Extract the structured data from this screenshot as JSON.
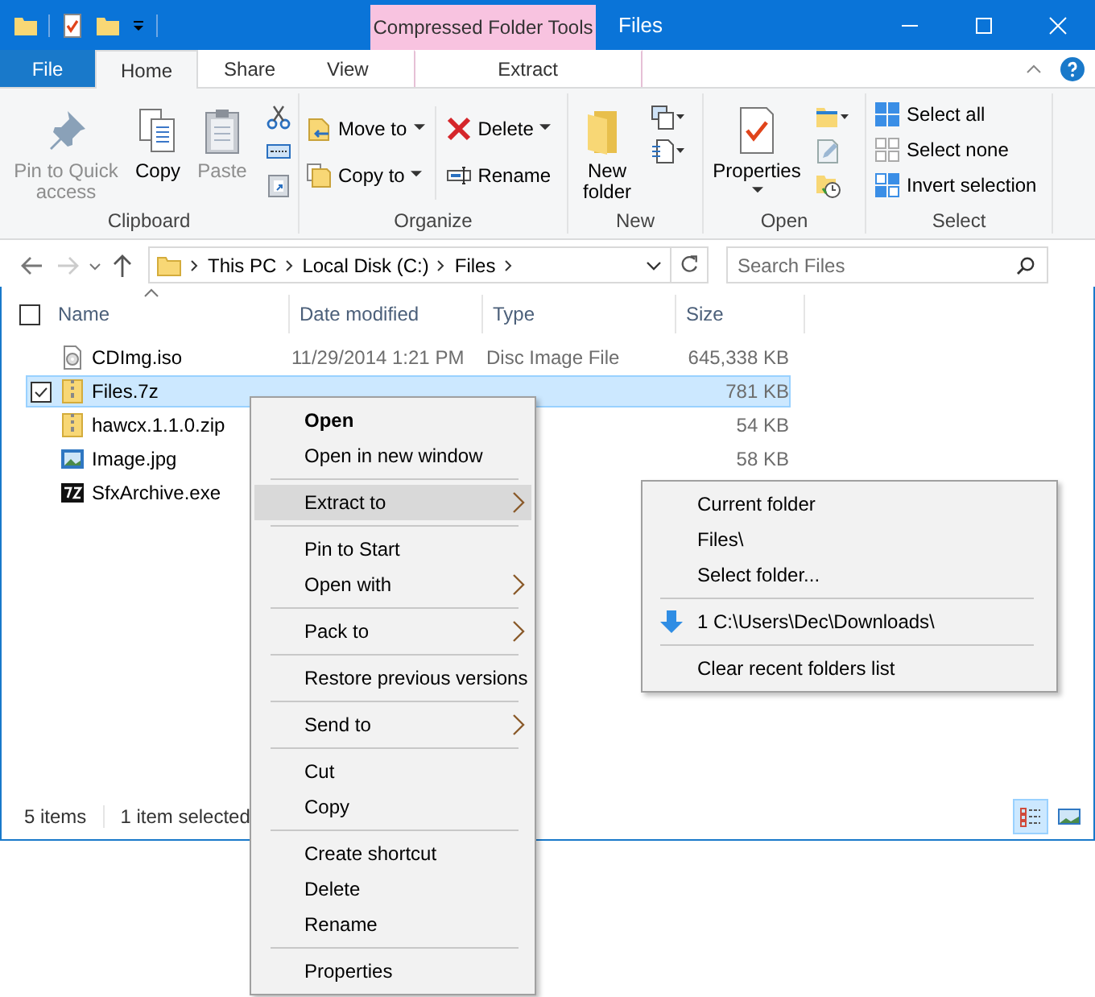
{
  "title_bar": {
    "title": "Files",
    "contextual_group": "Compressed Folder Tools"
  },
  "ribbon_tabs": [
    {
      "label": "File",
      "kind": "file",
      "selected": false
    },
    {
      "label": "Home",
      "kind": "normal",
      "selected": true
    },
    {
      "label": "Share",
      "kind": "normal",
      "selected": false
    },
    {
      "label": "View",
      "kind": "normal",
      "selected": false
    },
    {
      "label": "Extract",
      "kind": "contextual",
      "selected": false
    }
  ],
  "ribbon": {
    "clipboard": {
      "label": "Clipboard",
      "pin": {
        "label": "Pin to Quick access",
        "disabled": true
      },
      "copy": {
        "label": "Copy",
        "disabled": false
      },
      "paste": {
        "label": "Paste",
        "disabled": true
      }
    },
    "organize": {
      "label": "Organize",
      "move_to": {
        "label": "Move to"
      },
      "copy_to": {
        "label": "Copy to"
      },
      "delete": {
        "label": "Delete"
      },
      "rename": {
        "label": "Rename"
      }
    },
    "new": {
      "label": "New",
      "new_folder": {
        "label": "New folder"
      }
    },
    "open": {
      "label": "Open",
      "properties": {
        "label": "Properties"
      }
    },
    "select": {
      "label": "Select",
      "items": [
        "Select all",
        "Select none",
        "Invert selection"
      ]
    }
  },
  "address": {
    "crumbs": [
      "This PC",
      "Local Disk (C:)",
      "Files"
    ]
  },
  "search": {
    "placeholder": "Search Files"
  },
  "select_all": {
    "checked": false
  },
  "columns": [
    "Name",
    "Date modified",
    "Type",
    "Size"
  ],
  "files": [
    {
      "name": "CDImg.iso",
      "date": "11/29/2014 1:21 PM",
      "type": "Disc Image File",
      "size": "645,338 KB",
      "kind": "disc",
      "selected": false
    },
    {
      "name": "Files.7z",
      "size": "781 KB",
      "kind": "zip",
      "selected": true
    },
    {
      "name": "hawcx.1.1.0.zip",
      "size": "54 KB",
      "kind": "zip",
      "selected": false
    },
    {
      "name": "Image.jpg",
      "size": "58 KB",
      "kind": "image",
      "selected": false
    },
    {
      "name": "SfxArchive.exe",
      "kind": "exe",
      "selected": false
    }
  ],
  "status_bar": {
    "count": "5 items",
    "selection": "1 item selected"
  },
  "views": [
    {
      "kind": "details",
      "selected": true
    },
    {
      "kind": "tiles",
      "selected": false
    }
  ],
  "context_menu": {
    "groups": [
      [
        {
          "label": "Open",
          "bold": true,
          "arrow": false,
          "highlighted": false
        },
        {
          "label": "Open in new window",
          "bold": false,
          "arrow": false,
          "highlighted": false
        }
      ],
      [
        {
          "label": "Extract to",
          "bold": false,
          "arrow": true,
          "highlighted": true
        }
      ],
      [
        {
          "label": "Pin to Start",
          "bold": false,
          "arrow": false,
          "highlighted": false
        },
        {
          "label": "Open with",
          "bold": false,
          "arrow": true,
          "highlighted": false
        }
      ],
      [
        {
          "label": "Pack to",
          "bold": false,
          "arrow": true,
          "highlighted": false
        }
      ],
      [
        {
          "label": "Restore previous versions",
          "bold": false,
          "arrow": false,
          "highlighted": false
        }
      ],
      [
        {
          "label": "Send to",
          "bold": false,
          "arrow": true,
          "highlighted": false
        }
      ],
      [
        {
          "label": "Cut",
          "bold": false,
          "arrow": false,
          "highlighted": false
        },
        {
          "label": "Copy",
          "bold": false,
          "arrow": false,
          "highlighted": false
        }
      ],
      [
        {
          "label": "Create shortcut",
          "bold": false,
          "arrow": false,
          "highlighted": false
        },
        {
          "label": "Delete",
          "bold": false,
          "arrow": false,
          "highlighted": false
        },
        {
          "label": "Rename",
          "bold": false,
          "arrow": false,
          "highlighted": false
        }
      ],
      [
        {
          "label": "Properties",
          "bold": false,
          "arrow": false,
          "highlighted": false
        }
      ]
    ]
  },
  "submenu": {
    "groups": [
      [
        {
          "label": "Current folder",
          "kind": "plain"
        },
        {
          "label": "Files\\",
          "kind": "plain"
        },
        {
          "label": "Select folder...",
          "kind": "plain"
        }
      ],
      [
        {
          "label": "1 C:\\Users\\Dec\\Downloads\\",
          "kind": "recent"
        }
      ],
      [
        {
          "label": "Clear recent folders list",
          "kind": "plain"
        }
      ]
    ]
  }
}
